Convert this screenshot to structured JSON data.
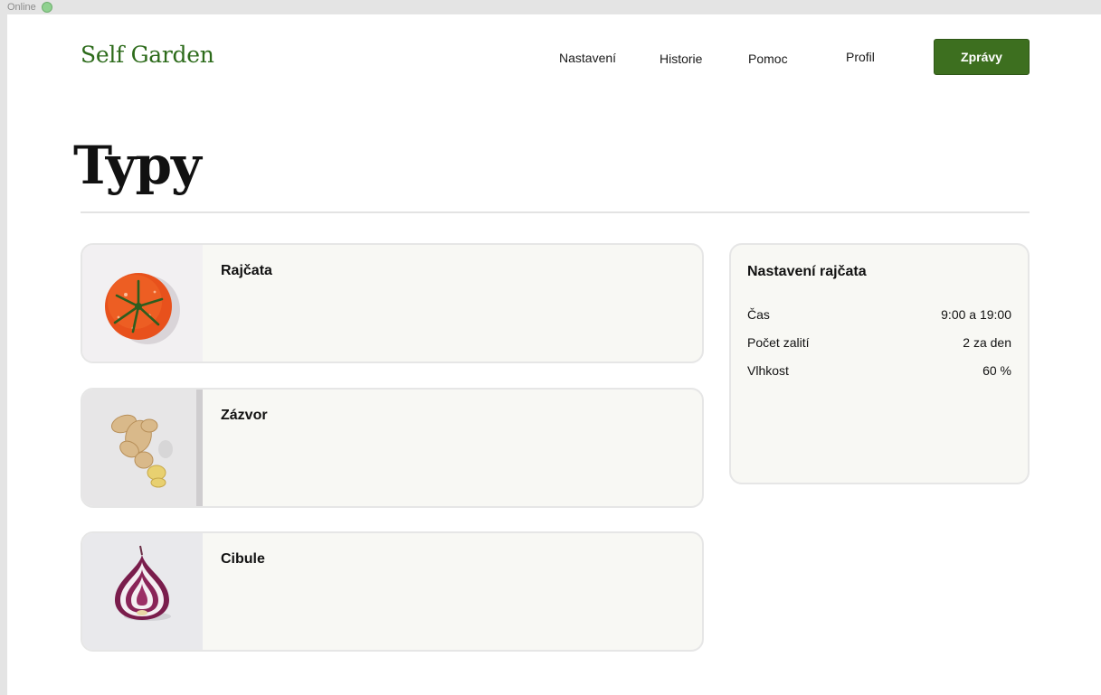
{
  "status": {
    "label": "Online",
    "color": "#8fd18f"
  },
  "header": {
    "logo": "Self Garden",
    "nav": [
      "Nastavení",
      "Historie",
      "Pomoc",
      "Profil"
    ],
    "cta_label": "Zprávy"
  },
  "main": {
    "title": "Typy",
    "plants": [
      {
        "name": "Rajčata",
        "icon": "tomato-image"
      },
      {
        "name": "Zázvor",
        "icon": "ginger-image"
      },
      {
        "name": "Cibule",
        "icon": "onion-image"
      }
    ]
  },
  "settings": {
    "title": "Nastavení rajčata",
    "rows": [
      {
        "label": "Čas",
        "value": "9:00 a 19:00"
      },
      {
        "label": "Počet zalití",
        "value": "2 za den"
      },
      {
        "label": "Vlhkost",
        "value": "60 %"
      }
    ]
  },
  "colors": {
    "brand": "#2d6b1b",
    "button": "#3d6f1f",
    "card_bg": "#f8f8f4"
  }
}
